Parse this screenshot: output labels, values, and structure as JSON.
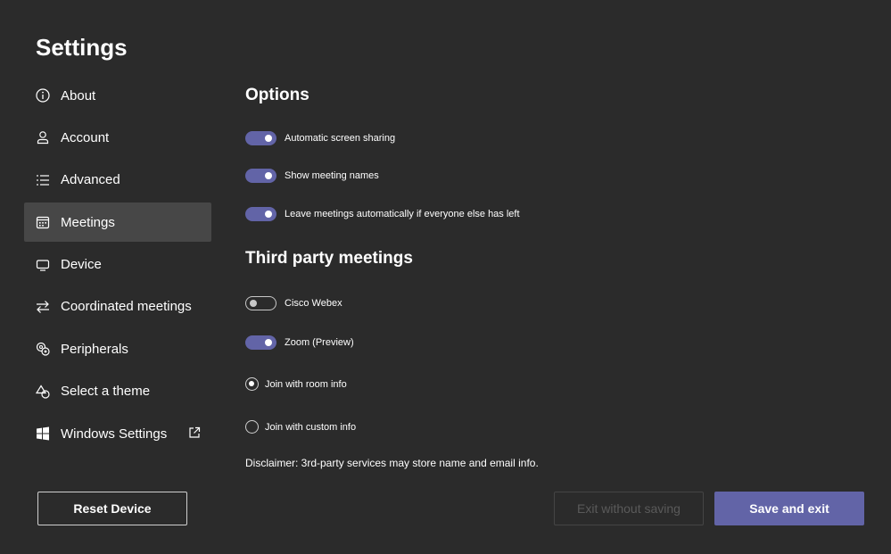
{
  "page": {
    "title": "Settings"
  },
  "sidebar": {
    "items": [
      {
        "label": "About",
        "icon": "info-icon",
        "active": false
      },
      {
        "label": "Account",
        "icon": "person-icon",
        "active": false
      },
      {
        "label": "Advanced",
        "icon": "list-icon",
        "active": false
      },
      {
        "label": "Meetings",
        "icon": "calendar-icon",
        "active": true
      },
      {
        "label": "Device",
        "icon": "monitor-icon",
        "active": false
      },
      {
        "label": "Coordinated meetings",
        "icon": "swap-arrows-icon",
        "active": false
      },
      {
        "label": "Peripherals",
        "icon": "peripherals-icon",
        "active": false
      },
      {
        "label": "Select a theme",
        "icon": "shapes-icon",
        "active": false
      },
      {
        "label": "Windows Settings",
        "icon": "windows-icon",
        "active": false,
        "external": "external-link-icon"
      }
    ]
  },
  "options": {
    "heading": "Options",
    "toggles": [
      {
        "label": "Automatic screen sharing",
        "on": true
      },
      {
        "label": "Show meeting names",
        "on": true
      },
      {
        "label": "Leave meetings automatically if everyone else has left",
        "on": true
      }
    ]
  },
  "third_party": {
    "heading": "Third party meetings",
    "toggles": [
      {
        "label": "Cisco Webex",
        "on": false
      },
      {
        "label": "Zoom (Preview)",
        "on": true
      }
    ],
    "radios": [
      {
        "label": "Join with room info",
        "checked": true
      },
      {
        "label": "Join with custom info",
        "checked": false
      }
    ],
    "disclaimer": "Disclaimer: 3rd-party services may store name and email info."
  },
  "footer": {
    "reset_label": "Reset Device",
    "exit_label": "Exit without saving",
    "save_label": "Save and exit"
  },
  "colors": {
    "accent": "#6264a7",
    "background": "#2b2b2b",
    "active_item": "#474747"
  }
}
